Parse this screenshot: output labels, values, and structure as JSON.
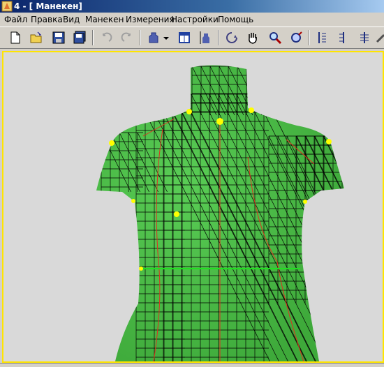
{
  "window": {
    "title": "4 - [ Манекен]"
  },
  "menu": [
    "Файл",
    "Правка",
    "Вид",
    "Манекен",
    "Измерения",
    "Настройки",
    "Помощь"
  ],
  "toolbar": {
    "buttons": [
      {
        "name": "new-document-icon"
      },
      {
        "name": "open-folder-icon"
      },
      {
        "name": "save-icon"
      },
      {
        "name": "save-all-icon"
      },
      {
        "name": "undo-icon",
        "disabled": true
      },
      {
        "name": "redo-icon",
        "disabled": true
      },
      {
        "name": "mannequin-icon"
      },
      {
        "name": "dropdown-arrow-icon"
      },
      {
        "name": "window-icon"
      },
      {
        "name": "figure-measure-icon"
      },
      {
        "name": "rotate-icon"
      },
      {
        "name": "pan-hand-icon"
      },
      {
        "name": "zoom-icon"
      },
      {
        "name": "orbit-icon"
      },
      {
        "name": "vertical-measure-icon"
      },
      {
        "name": "vertical-measure-2-icon"
      },
      {
        "name": "vertical-measure-3-icon"
      },
      {
        "name": "pencil-icon"
      }
    ]
  },
  "colors": {
    "body_green": "#4ec24a",
    "mesh": "#000000",
    "seam_red": "#e03020",
    "landmark": "#ffff00",
    "guide_line": "#22dd22",
    "viewport_border": "#ffe500"
  }
}
